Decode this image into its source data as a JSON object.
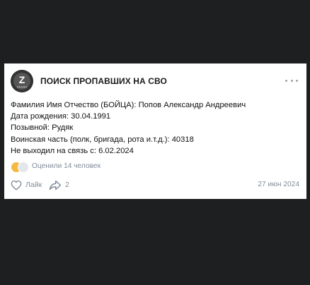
{
  "post": {
    "community_name": "ПОИСК ПРОПАВШИХ НА СВО",
    "avatar_label": "Z",
    "avatar_sub": "RNUAR",
    "lines": [
      "Фамилия Имя Отчество (БОЙЦА): Попов Александр Андреевич",
      "Дата рождения: 30.04.1991",
      "Позывной: Рудяк",
      "Воинская часть (полк, бригада, рота и.т.д.): 40318",
      "Не выходил на связь с: 6.02.2024"
    ],
    "reactions_text": "Оценили 14 человек",
    "like_label": "Лайк",
    "share_count": "2",
    "date": "27 июн 2024"
  },
  "icons": {
    "menu": "more-dots-icon",
    "like": "heart-icon",
    "share": "share-arrow-icon"
  }
}
